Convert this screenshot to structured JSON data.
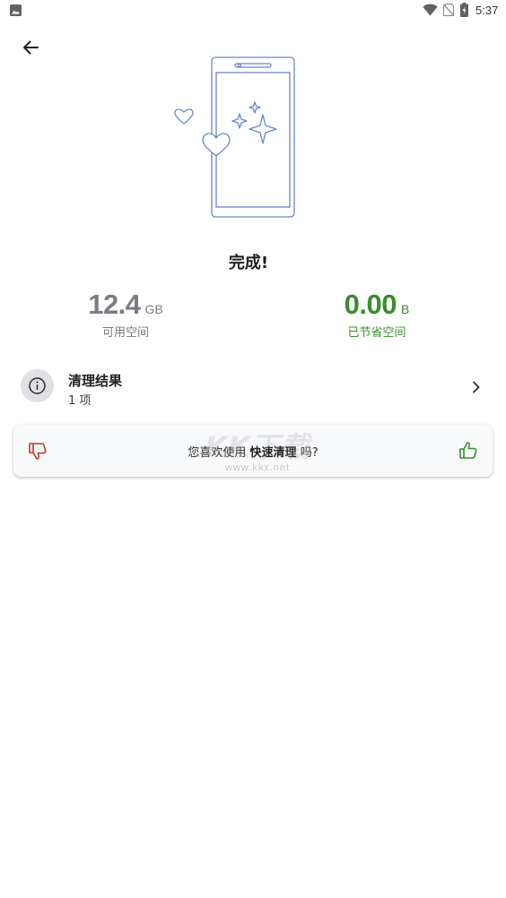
{
  "status_bar": {
    "time": "5:37",
    "icons": [
      "gallery-icon",
      "wifi-icon",
      "no-sim-icon",
      "battery-icon"
    ]
  },
  "header": {
    "back_icon": "arrow-left-icon"
  },
  "result": {
    "title": "完成!"
  },
  "stats": {
    "available": {
      "value": "12.4",
      "unit": "GB",
      "label": "可用空间",
      "color": "#7a7d85"
    },
    "saved": {
      "value": "0.00",
      "unit": "B",
      "label": "已节省空间",
      "color": "#3b8c2e"
    }
  },
  "cleanup_results": {
    "icon": "info-icon",
    "title": "清理结果",
    "subtitle": "1 项",
    "chevron_icon": "chevron-right-icon"
  },
  "feedback": {
    "prefix": "您喜欢使用",
    "feature": "快速清理",
    "suffix": "吗?",
    "thumb_down_icon": "thumb-down-icon",
    "thumb_down_color": "#c0392b",
    "thumb_up_icon": "thumb-up-icon",
    "thumb_up_color": "#3b8c2e"
  },
  "watermark": {
    "logo_text": "KK下载",
    "url": "www.kkx.net"
  }
}
